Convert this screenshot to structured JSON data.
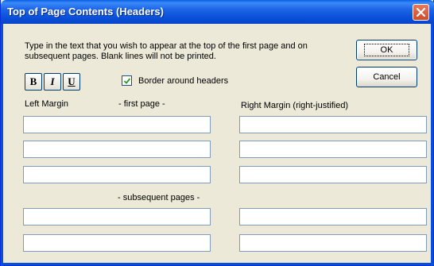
{
  "window": {
    "title": "Top of Page Contents (Headers)"
  },
  "instructions": "Type in the text that you wish to appear at the top of the first page and on subsequent pages.  Blank lines will not be printed.",
  "buttons": {
    "ok": "OK",
    "cancel": "Cancel"
  },
  "format_buttons": {
    "bold": "B",
    "italic": "I",
    "underline": "U"
  },
  "border_checkbox": {
    "label": "Border around headers",
    "checked": true
  },
  "labels": {
    "left_margin": "Left Margin",
    "first_page": "- first page -",
    "right_margin": "Right Margin (right-justified)",
    "subsequent_pages": "- subsequent pages -"
  },
  "fields": {
    "first_page_left": [
      "",
      "",
      ""
    ],
    "first_page_right": [
      "",
      "",
      ""
    ],
    "subsequent_left": [
      "",
      ""
    ],
    "subsequent_right": [
      "",
      ""
    ]
  },
  "colors": {
    "titlebar": "#0a4fd8",
    "dialog_bg": "#ece9d8",
    "close_button": "#d24b2a",
    "field_border": "#7f9db9"
  },
  "icons": {
    "close": "close-icon",
    "check": "check-icon"
  }
}
